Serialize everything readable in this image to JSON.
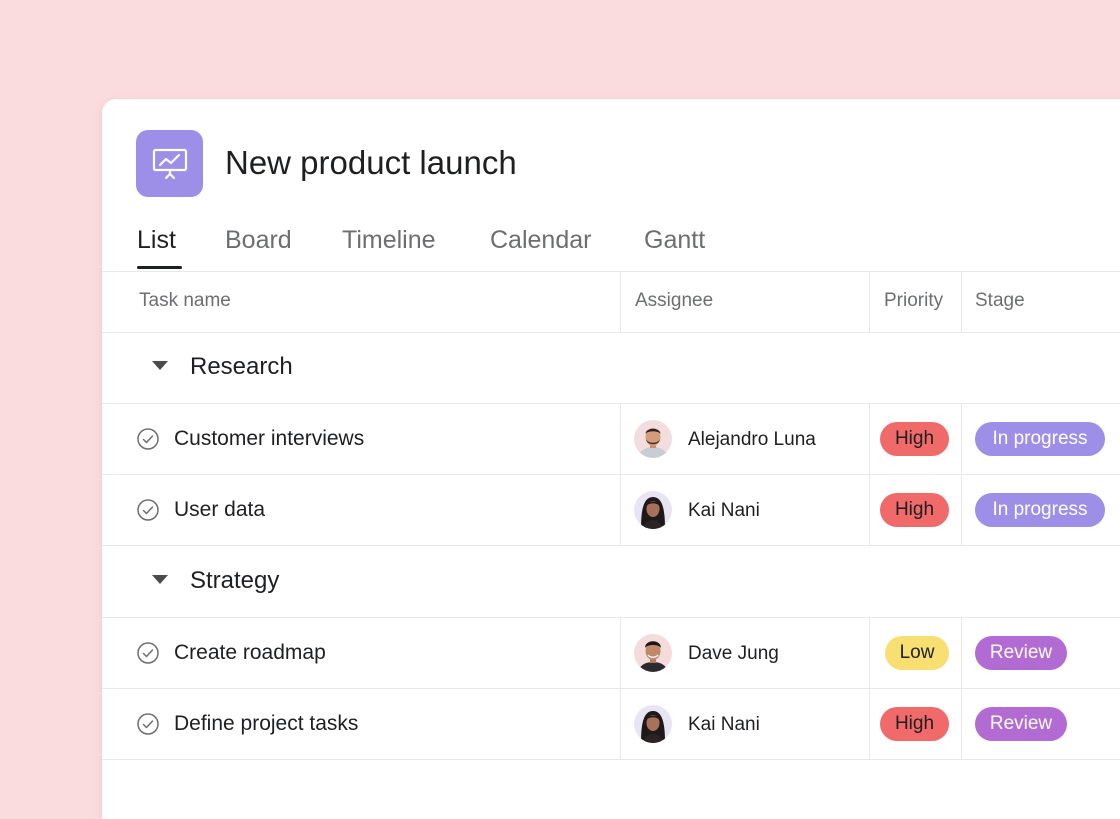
{
  "project": {
    "title": "New product launch",
    "icon": "presentation-chart-icon",
    "icon_color": "#9d8ee8"
  },
  "tabs": [
    {
      "label": "List",
      "active": true
    },
    {
      "label": "Board",
      "active": false
    },
    {
      "label": "Timeline",
      "active": false
    },
    {
      "label": "Calendar",
      "active": false
    },
    {
      "label": "Gantt",
      "active": false
    }
  ],
  "columns": {
    "task": "Task name",
    "assignee": "Assignee",
    "priority": "Priority",
    "stage": "Stage"
  },
  "sections": [
    {
      "label": "Research",
      "tasks": [
        {
          "name": "Customer interviews",
          "assignee": "Alejandro Luna",
          "priority": "High",
          "stage": "In progress"
        },
        {
          "name": "User data",
          "assignee": "Kai Nani",
          "priority": "High",
          "stage": "In progress"
        }
      ]
    },
    {
      "label": "Strategy",
      "tasks": [
        {
          "name": "Create roadmap",
          "assignee": "Dave Jung",
          "priority": "Low",
          "stage": "Review"
        },
        {
          "name": "Define project tasks",
          "assignee": "Kai Nani",
          "priority": "High",
          "stage": "Review"
        }
      ]
    }
  ],
  "colors": {
    "background": "#fbdcde",
    "priority_high": "#f06a6a",
    "priority_low": "#f8df72",
    "stage_in_progress": "#9d8ee8",
    "stage_review": "#b36bd4"
  }
}
